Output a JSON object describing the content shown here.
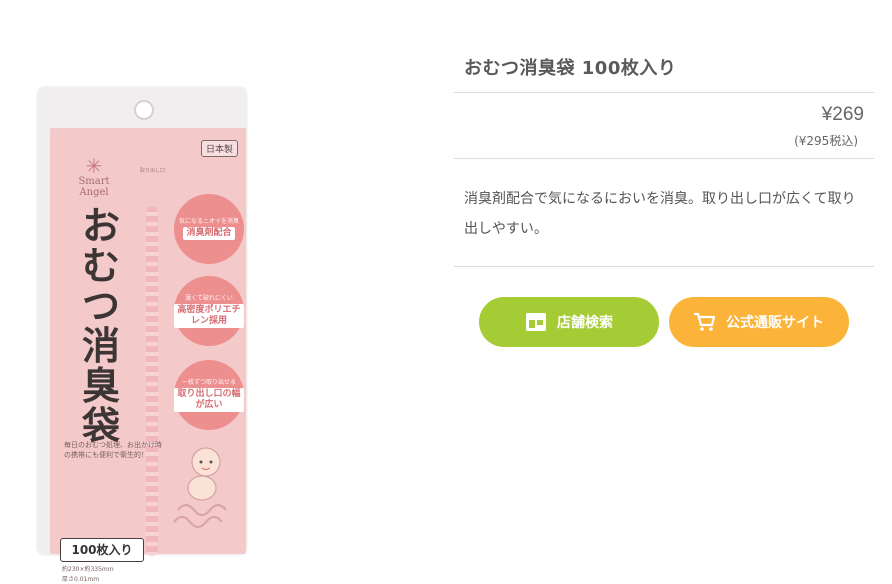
{
  "colors": {
    "store_button": "#a5cc35",
    "shop_button": "#fbb439",
    "package_pink": "#f4c9c9",
    "badge_pink": "#ee8f8f"
  },
  "product": {
    "title": "おむつ消臭袋 100枚入り",
    "price": "¥269",
    "price_tax": "(¥295税込)",
    "description": "消臭剤配合で気になるにおいを消臭。取り出し口が広くて取り出しやすい。"
  },
  "buttons": {
    "store_search": {
      "label": "店舗検索",
      "icon": "store-icon"
    },
    "online_shop": {
      "label": "公式通販サイト",
      "icon": "cart-icon"
    }
  },
  "package": {
    "made_in": "日本製",
    "brand_line1": "Smart",
    "brand_line2": "Angel",
    "name_vertical": "おむつ消臭袋",
    "open_hint": "取り出し口",
    "badges": [
      {
        "small": "気になるニオイを消臭",
        "main": "消臭剤配合"
      },
      {
        "small": "薄くて破れにくい",
        "main": "高密度ポリエチレン採用"
      },
      {
        "small": "一枚ずつ取り出せる",
        "main": "取り出し口の幅が広い"
      }
    ],
    "copy": "毎日のおむつ処理、お出かけ時の携帯にも便利で衛生的！",
    "count": "100枚入り",
    "size_spec": "約230×約335mm",
    "thickness_spec": "厚さ0.01mm"
  }
}
